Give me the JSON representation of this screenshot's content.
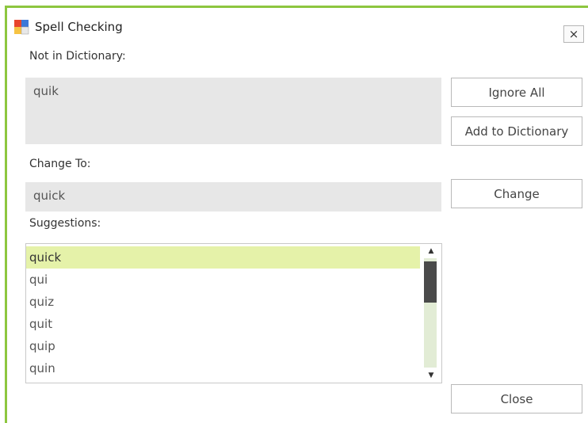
{
  "window": {
    "title": "Spell Checking",
    "close_glyph": "×",
    "icon": "spellcheck-app-icon"
  },
  "not_in_dictionary": {
    "label": "Not in Dictionary:",
    "value": "quik"
  },
  "change_to": {
    "label": "Change To:",
    "value": "quick"
  },
  "suggestions": {
    "label": "Suggestions:",
    "selected_index": 0,
    "items": [
      "quick",
      "qui",
      "quiz",
      "quit",
      "quip",
      "quin"
    ]
  },
  "buttons": {
    "ignore_all": "Ignore All",
    "add_to_dictionary": "Add to Dictionary",
    "change": "Change",
    "close": "Close"
  },
  "scrollbar": {
    "up_glyph": "▲",
    "down_glyph": "▼"
  },
  "colors": {
    "accent_frame": "#8dc63f",
    "selection": "#e5f2a9"
  }
}
